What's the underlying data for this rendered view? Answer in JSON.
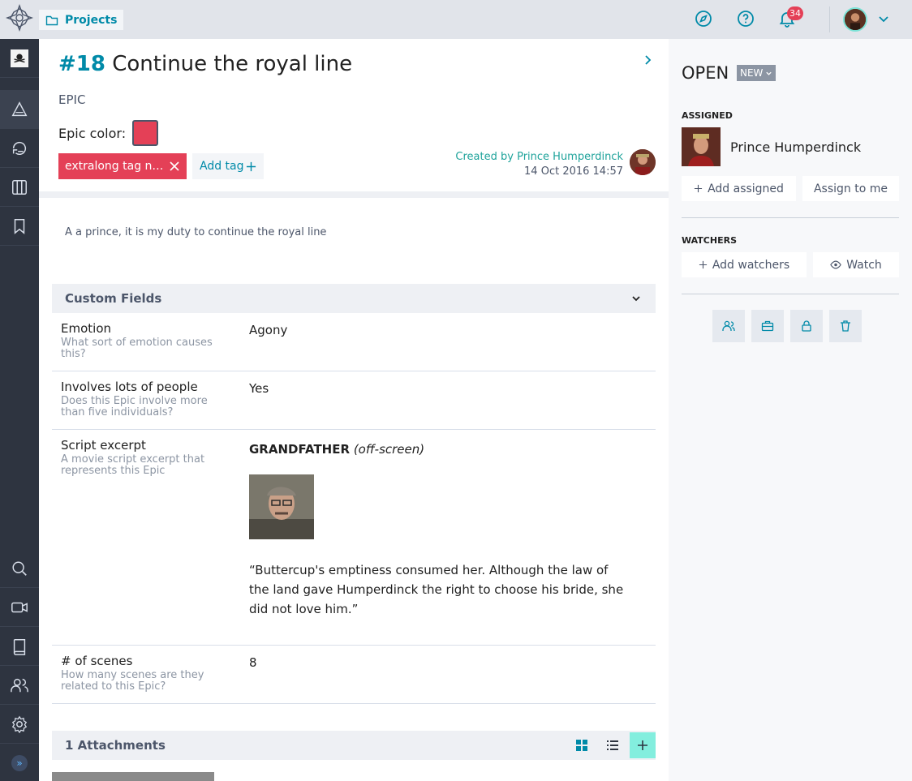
{
  "topbar": {
    "projects_label": "Projects",
    "notification_count": "34",
    "icons": [
      "discover-icon",
      "help-icon",
      "bell-icon",
      "chevron-down-icon"
    ]
  },
  "leftnav": {
    "items": [
      "project-logo",
      "epics-icon",
      "backlog-icon",
      "kanban-icon",
      "wiki-bookmark-icon"
    ],
    "bottom_items": [
      "search-icon",
      "video-icon",
      "book-icon",
      "team-icon",
      "settings-icon"
    ],
    "expand_label": "»"
  },
  "issue": {
    "ref": "#18",
    "title": "Continue the royal line",
    "type": "EPIC",
    "epic_color_label": "Epic color:",
    "epic_color": "#e44057",
    "tag": "extralong tag na…",
    "add_tag_label": "Add tag",
    "created_by": "Created by Prince Humperdinck",
    "created_date": "14 Oct 2016 14:57",
    "description": "A a prince, it is my duty to continue the royal line"
  },
  "custom_fields": {
    "heading": "Custom Fields",
    "rows": [
      {
        "name": "Emotion",
        "desc": "What sort of emotion causes this?",
        "value": "Agony"
      },
      {
        "name": "Involves lots of people",
        "desc": "Does this Epic involve more than five individuals?",
        "value": "Yes"
      },
      {
        "name": "Script excerpt",
        "desc": "A movie script excerpt that represents this Epic",
        "speaker": "GRANDFATHER",
        "paren": "(off-screen)",
        "quote": "“Buttercup's emptiness consumed her. Although the law of the land gave Humperdinck the right to choose his bride, she did not love him.”"
      },
      {
        "name": "# of scenes",
        "desc": "How many scenes are they related to this Epic?",
        "value": "8"
      }
    ]
  },
  "attachments": {
    "heading": "1 Attachments"
  },
  "sidebar": {
    "status": "OPEN",
    "status_badge": "NEW",
    "assigned_label": "ASSIGNED",
    "assignee": "Prince Humperdinck",
    "add_assigned": "Add assigned",
    "assign_to_me": "Assign to me",
    "watchers_label": "WATCHERS",
    "add_watchers": "Add watchers",
    "watch": "Watch"
  },
  "colors": {
    "accent": "#008aa8",
    "tag": "#e44057",
    "nav_bg": "#2e3440",
    "add_button": "#83eede"
  }
}
